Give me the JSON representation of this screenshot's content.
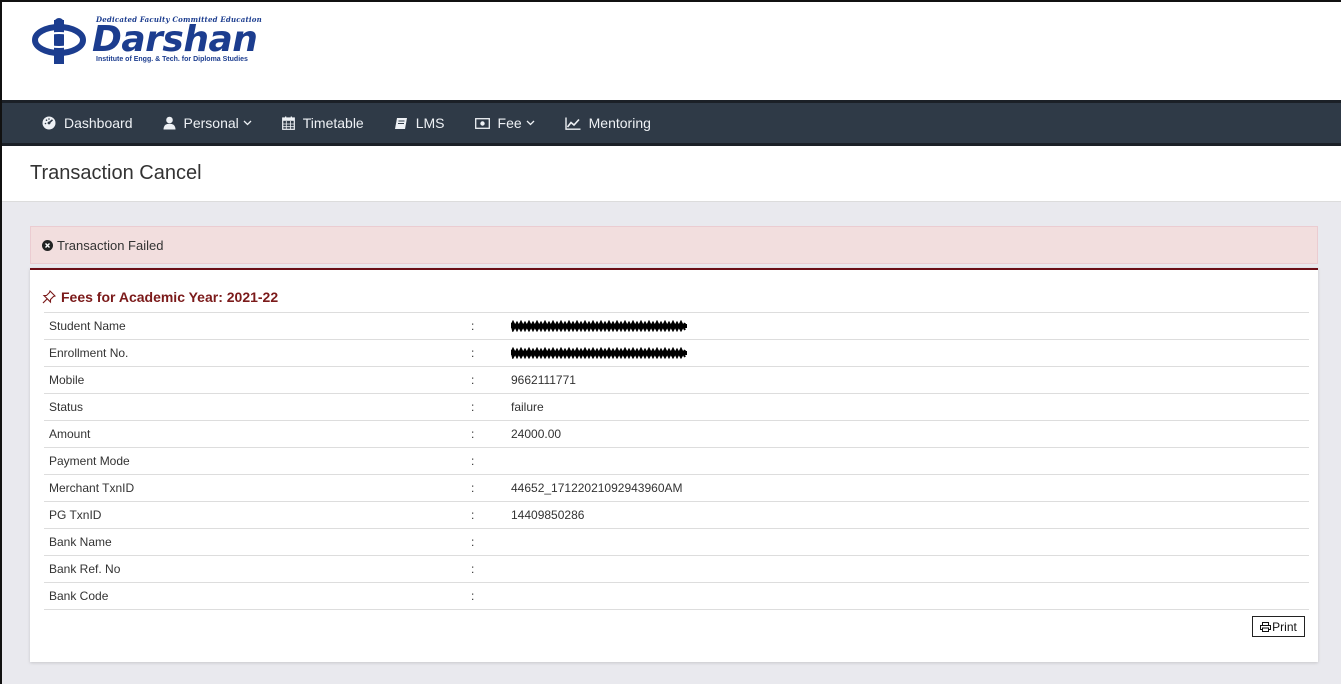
{
  "logo": {
    "tagline": "Dedicated Faculty Committed Education",
    "name": "Darshan",
    "subtitle": "Institute of Engg. & Tech. for Diploma Studies"
  },
  "nav": {
    "items": [
      {
        "label": "Dashboard",
        "icon": "tachometer-icon"
      },
      {
        "label": "Personal",
        "icon": "user-icon",
        "dropdown": true
      },
      {
        "label": "Timetable",
        "icon": "calendar-icon"
      },
      {
        "label": "LMS",
        "icon": "book-icon"
      },
      {
        "label": "Fee",
        "icon": "money-icon",
        "dropdown": true
      },
      {
        "label": "Mentoring",
        "icon": "line-chart-icon"
      }
    ]
  },
  "page": {
    "title": "Transaction Cancel"
  },
  "alert": {
    "text": "Transaction Failed",
    "icon": "times-circle-icon"
  },
  "card": {
    "title": "Fees for Academic Year: 2021-22",
    "icon": "thumbtack-icon",
    "separator": ":",
    "rows": [
      {
        "label": "Student Name",
        "value": "",
        "redacted": true
      },
      {
        "label": "Enrollment No.",
        "value": "",
        "redacted": true
      },
      {
        "label": "Mobile",
        "value": "9662111771"
      },
      {
        "label": "Status",
        "value": "failure"
      },
      {
        "label": "Amount",
        "value": "24000.00"
      },
      {
        "label": "Payment Mode",
        "value": ""
      },
      {
        "label": "Merchant TxnID",
        "value": "44652_17122021092943960AM"
      },
      {
        "label": "PG TxnID",
        "value": "14409850286"
      },
      {
        "label": "Bank Name",
        "value": ""
      },
      {
        "label": "Bank Ref. No",
        "value": ""
      },
      {
        "label": "Bank Code",
        "value": ""
      }
    ],
    "print_label": "Print"
  },
  "colors": {
    "brand": "#1c3d8f",
    "nav_bg": "#2f3a47",
    "alert_bg": "#f2dede",
    "card_accent": "#6b0f17",
    "card_title": "#7b1a1a"
  }
}
